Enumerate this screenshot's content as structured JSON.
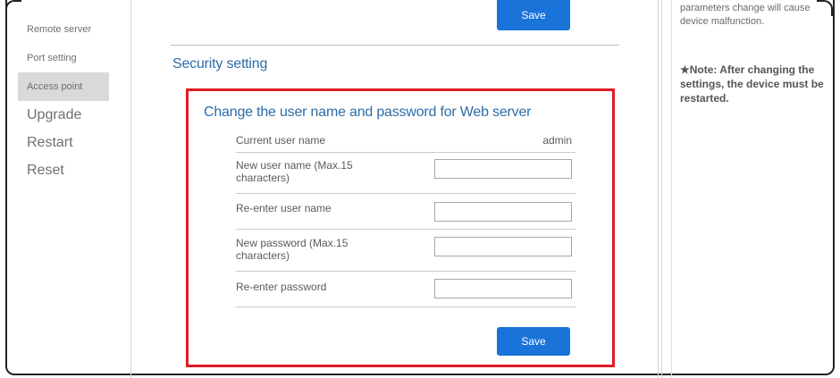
{
  "sidebar": {
    "items": [
      {
        "label": "Remote server"
      },
      {
        "label": "Port setting"
      },
      {
        "label": "Access point"
      },
      {
        "label": "Upgrade"
      },
      {
        "label": "Restart"
      },
      {
        "label": "Reset"
      }
    ],
    "active_index": 2
  },
  "top": {
    "save_label": "Save"
  },
  "section": {
    "title": "Security setting"
  },
  "form": {
    "title": "Change the user name and password for Web server",
    "current_user_label": "Current user name",
    "current_user_value": "admin",
    "new_user_label": "New user name (Max.15 characters)",
    "reenter_user_label": "Re-enter user name",
    "new_password_label": "New password (Max.15 characters)",
    "reenter_password_label": "Re-enter password",
    "save_label": "Save"
  },
  "notes": {
    "warning": "parameters change will cause device malfunction.",
    "restart_note": "★Note: After changing the settings, the device must be restarted."
  },
  "colors": {
    "accent": "#1a73d9",
    "title_blue": "#2c6da6",
    "highlight_red": "#e11d27",
    "active_bg": "#d9d9d9"
  }
}
